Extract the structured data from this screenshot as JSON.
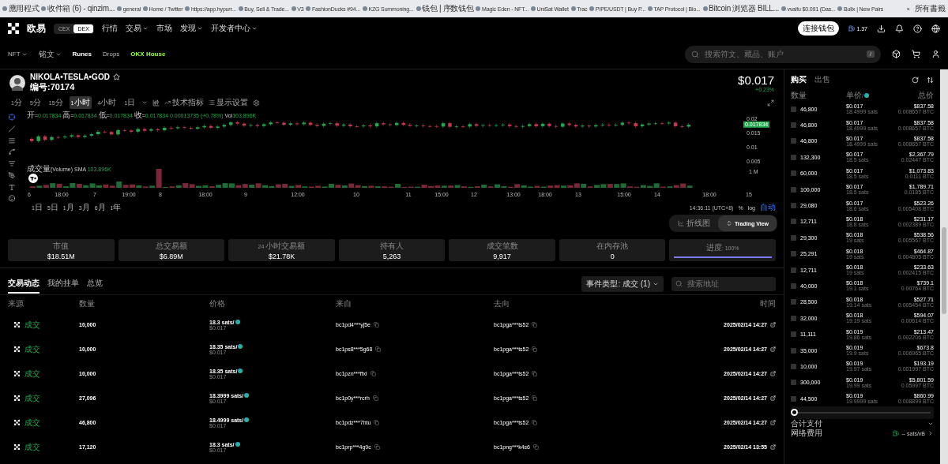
{
  "bookmarks": [
    {
      "label": "應用程式"
    },
    {
      "label": "收件箱 (6) - qinzim..."
    },
    {
      "label": "general"
    },
    {
      "label": "Home / Twitter"
    },
    {
      "label": "https://app.hypurr..."
    },
    {
      "label": "Buy, Sell & Trade..."
    },
    {
      "label": "V3"
    },
    {
      "label": "FashionDucks #94..."
    },
    {
      "label": "KZG Summoning..."
    },
    {
      "label": "钱包 | 序数钱包"
    },
    {
      "label": "Magic Eden - NFT..."
    },
    {
      "label": "UniSat Wallet"
    },
    {
      "label": "Trac"
    },
    {
      "label": "PIPE/USDT | Buy P..."
    },
    {
      "label": "TAP Protocol | Blo..."
    },
    {
      "label": "Bitcoin 浏览器 BILL..."
    },
    {
      "label": "vvaifu $0.091 (Das..."
    },
    {
      "label": "Bullx | New Pairs"
    }
  ],
  "bookmarks_more": "»",
  "bookmarks_all": "所有書籤",
  "nav": {
    "logo": "欧易",
    "mode_toggle": [
      {
        "label": "CEX",
        "selected": false
      },
      {
        "label": "DEX",
        "selected": true
      }
    ],
    "menu": [
      {
        "label": "行情",
        "dropdown": false
      },
      {
        "label": "交易",
        "dropdown": true
      },
      {
        "label": "市场",
        "dropdown": false
      },
      {
        "label": "发现",
        "dropdown": true
      },
      {
        "label": "开发者中心",
        "dropdown": true
      }
    ],
    "connect_button": "连接钱包",
    "gas": "1.37"
  },
  "subnav": {
    "items": [
      {
        "label": "NFT",
        "dropdown": true,
        "selected": false,
        "kind": "plain"
      },
      {
        "label": "铭文",
        "dropdown": true,
        "selected": false,
        "kind": "plain"
      },
      {
        "label": "Runes",
        "dropdown": false,
        "selected": true,
        "kind": "plain"
      },
      {
        "label": "Drops",
        "dropdown": false,
        "selected": false,
        "kind": "plain"
      },
      {
        "label": "OKX House",
        "dropdown": false,
        "selected": false,
        "kind": "highlight"
      }
    ],
    "search": {
      "placeholder": "搜索符文、藏品、账户",
      "shortcut": "/"
    }
  },
  "token": {
    "name": "NIKOLA•TESLA•GOD",
    "number": "编号:70174",
    "price": "$0.017",
    "change": "+0.23%"
  },
  "timeframes": [
    {
      "label": "1分",
      "selected": false
    },
    {
      "label": "5分",
      "selected": false
    },
    {
      "label": "15分",
      "selected": false
    },
    {
      "label": "1小时",
      "selected": true
    },
    {
      "label": "4小时",
      "selected": false
    },
    {
      "label": "1日",
      "selected": false
    }
  ],
  "toolbar": {
    "indicators": "技术指标",
    "display": "显示设置"
  },
  "chart": {
    "legend": [
      {
        "label": "开=",
        "value": "0.017834"
      },
      {
        "label": "高=",
        "value": "0.017834"
      },
      {
        "label": "低=",
        "value": "0.017834"
      },
      {
        "label": "收=",
        "value": "0.017834"
      }
    ],
    "legend_change": "0.00013735 (+0.78%)",
    "legend_vol_label": "Vol",
    "legend_vol_value": "103.896K",
    "price_ticks": [
      "0.02",
      "0.015",
      "0.01",
      "0.005"
    ],
    "last_price": "0.017834",
    "volume_legend": "成交量(Volume)",
    "sma_label": "SMA",
    "sma_value": "103.896K",
    "volume_tick": "1 M",
    "x_ticks": [
      "6",
      "18:00",
      "7",
      "19:00",
      "8",
      "18:00",
      "9",
      "12:00",
      "10",
      "11",
      "15:00",
      "12",
      "13:00",
      "18:00",
      "13",
      "15:00",
      "14",
      "18:00",
      "15"
    ]
  },
  "ranges": [
    "1日",
    "5日",
    "1月",
    "3月",
    "6月",
    "1年"
  ],
  "clock": "14:36:11 (UTC+8)",
  "scale_options": [
    {
      "label": "%",
      "selected": false
    },
    {
      "label": "log",
      "selected": false
    },
    {
      "label": "自动",
      "selected": true
    }
  ],
  "view_toggle": [
    {
      "label": "折线图",
      "selected": false
    },
    {
      "label": "Trading View",
      "selected": true
    }
  ],
  "stats": [
    {
      "label": "市值",
      "value": "$18.51M",
      "kind": "value"
    },
    {
      "label": "总交易额",
      "value": "$6.89M",
      "kind": "value"
    },
    {
      "label": "24 小时交易额",
      "value": "$21.78K",
      "kind": "value"
    },
    {
      "label": "持有人",
      "value": "5,263",
      "kind": "value"
    },
    {
      "label": "成交笔数",
      "value": "9,917",
      "kind": "value"
    },
    {
      "label": "在内存池",
      "value": "0",
      "kind": "value"
    },
    {
      "label": "进度: 100%",
      "level": 1,
      "kind": "progress"
    }
  ],
  "activity_tabs": [
    {
      "label": "交易动态",
      "selected": true
    },
    {
      "label": "我的挂单",
      "selected": false
    },
    {
      "label": "总览",
      "selected": false
    }
  ],
  "event_filter": "事件类型: 成交 (1)",
  "address_search": {
    "placeholder": "搜索地址"
  },
  "table": {
    "columns": [
      "来源",
      "数量",
      "价格",
      "来自",
      "去向",
      "时间"
    ],
    "rows": [
      {
        "source": "成交",
        "quantity": "10,000",
        "price_sats": "18.3 sats/",
        "price_usd": "$0.017",
        "from": "bc1pd4***yj5e",
        "to": "bc1pga***ts52",
        "time": "2025/02/14 14:27"
      },
      {
        "source": "成交",
        "quantity": "10,000",
        "price_sats": "18.35 sats/",
        "price_usd": "$0.017",
        "from": "bc1ps8***5g68",
        "to": "bc1pga***ts52",
        "time": "2025/02/14 14:27"
      },
      {
        "source": "成交",
        "quantity": "10,000",
        "price_sats": "18.35 sats/",
        "price_usd": "$0.017",
        "from": "bc1pzn***ffxl",
        "to": "bc1pga***ts52",
        "time": "2025/02/14 14:27"
      },
      {
        "source": "成交",
        "quantity": "27,096",
        "price_sats": "18.3999 sats/",
        "price_usd": "$0.017",
        "from": "bc1p0y***rcrh",
        "to": "bc1pga***ts52",
        "time": "2025/02/14 14:27"
      },
      {
        "source": "成交",
        "quantity": "46,800",
        "price_sats": "18.4999 sats/",
        "price_usd": "$0.017",
        "from": "bc1pdz***7htu",
        "to": "bc1pga***ts52",
        "time": "2025/02/14 14:27"
      },
      {
        "source": "成交",
        "quantity": "17,120",
        "price_sats": "18.3 sats/",
        "price_usd": "$0.017",
        "from": "bc1prp***4g9c",
        "to": "bc1png***k4s6",
        "time": "2025/02/14 13:55"
      }
    ]
  },
  "order_panel": {
    "tabs": [
      {
        "label": "购买",
        "selected": true
      },
      {
        "label": "出售",
        "selected": false
      }
    ],
    "columns": [
      "数量",
      "单价/",
      "总价"
    ],
    "rows": [
      {
        "quantity": "46,800",
        "price_usd": "$0.017",
        "price_sats": "18.4999 sats",
        "total_usd": "$837.58",
        "total_btc": "0.008657 BTC",
        "checked": false
      },
      {
        "quantity": "46,800",
        "price_usd": "$0.017",
        "price_sats": "18.4999 sats",
        "total_usd": "$837.58",
        "total_btc": "0.008657 BTC",
        "checked": false
      },
      {
        "quantity": "46,800",
        "price_usd": "$0.017",
        "price_sats": "18.4999 sats",
        "total_usd": "$837.58",
        "total_btc": "0.008657 BTC",
        "checked": false
      },
      {
        "quantity": "132,300",
        "price_usd": "$0.017",
        "price_sats": "18.5 sats",
        "total_usd": "$2,367.79",
        "total_btc": "0.02447 BTC",
        "checked": false
      },
      {
        "quantity": "60,000",
        "price_usd": "$0.017",
        "price_sats": "18.5 sats",
        "total_usd": "$1,073.83",
        "total_btc": "0.0111 BTC",
        "checked": false
      },
      {
        "quantity": "100,000",
        "price_usd": "$0.017",
        "price_sats": "18.5 sats",
        "total_usd": "$1,789.71",
        "total_btc": "0.0185 BTC",
        "checked": false
      },
      {
        "quantity": "29,080",
        "price_usd": "$0.017",
        "price_sats": "18.6 sats",
        "total_usd": "$523.26",
        "total_btc": "0.005408 BTC",
        "checked": false
      },
      {
        "quantity": "12,711",
        "price_usd": "$0.018",
        "price_sats": "18.8 sats",
        "total_usd": "$231.17",
        "total_btc": "0.002389 BTC",
        "checked": false
      },
      {
        "quantity": "29,300",
        "price_usd": "$0.018",
        "price_sats": "19 sats",
        "total_usd": "$538.56",
        "total_btc": "0.005567 BTC",
        "checked": false
      },
      {
        "quantity": "25,291",
        "price_usd": "$0.018",
        "price_sats": "19 sats",
        "total_usd": "$464.87",
        "total_btc": "0.004805 BTC",
        "checked": false
      },
      {
        "quantity": "12,711",
        "price_usd": "$0.018",
        "price_sats": "19 sats",
        "total_usd": "$233.63",
        "total_btc": "0.002415 BTC",
        "checked": false
      },
      {
        "quantity": "40,000",
        "price_usd": "$0.018",
        "price_sats": "19.1 sats",
        "total_usd": "$739.1",
        "total_btc": "0.00764 BTC",
        "checked": false
      },
      {
        "quantity": "28,500",
        "price_usd": "$0.018",
        "price_sats": "19.14 sats",
        "total_usd": "$527.71",
        "total_btc": "0.005454 BTC",
        "checked": false
      },
      {
        "quantity": "32,000",
        "price_usd": "$0.018",
        "price_sats": "19.19 sats",
        "total_usd": "$594.07",
        "total_btc": "0.00614 BTC",
        "checked": false
      },
      {
        "quantity": "11,111",
        "price_usd": "$0.019",
        "price_sats": "19.86 sats",
        "total_usd": "$213.47",
        "total_btc": "0.002206 BTC",
        "checked": false
      },
      {
        "quantity": "35,000",
        "price_usd": "$0.019",
        "price_sats": "19.9 sats",
        "total_usd": "$673.8",
        "total_btc": "0.006965 BTC",
        "checked": false
      },
      {
        "quantity": "10,000",
        "price_usd": "$0.019",
        "price_sats": "19.97 sats",
        "total_usd": "$193.19",
        "total_btc": "0.001997 BTC",
        "checked": false
      },
      {
        "quantity": "300,000",
        "price_usd": "$0.019",
        "price_sats": "19.99 sats",
        "total_usd": "$5,801.59",
        "total_btc": "0.05997 BTC",
        "checked": false
      },
      {
        "quantity": "44,500",
        "price_usd": "$0.019",
        "price_sats": "19.9999 sats",
        "total_usd": "$860.99",
        "total_btc": "0.008899 BTC",
        "checked": false
      }
    ],
    "slider": {
      "level": 0
    },
    "total_label": "合计支付",
    "fee_label": "网络费用",
    "fee_value": "-- sats/vB"
  }
}
